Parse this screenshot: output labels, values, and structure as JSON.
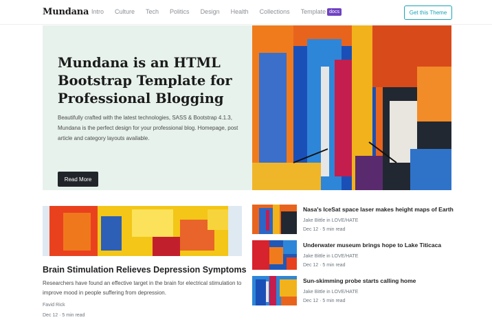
{
  "navbar": {
    "brand": "Mundana",
    "links": [
      "Intro",
      "Culture",
      "Tech",
      "Politics",
      "Design",
      "Health",
      "Collections"
    ],
    "template_label": "Template",
    "docs_badge": "docs",
    "cta": "Get this Theme"
  },
  "hero": {
    "title": "Mundana is an HTML Bootstrap Template for Professional Blogging",
    "text": "Beautifully crafted with the latest technologies, SASS & Bootstrap 4.1.3, Mundana is the perfect design for your professional blog. Homepage, post article and category layouts available.",
    "button": "Read More"
  },
  "featured": {
    "title": "Brain Stimulation Relieves Depression Symptoms",
    "text": "Researchers have found an effective target in the brain for electrical stimulation to improve mood in people suffering from depression.",
    "author": "Favid Rick",
    "date": "Dec 12 · 5 min read"
  },
  "side_articles": [
    {
      "title": "Nasa's IceSat space laser makes height maps of Earth",
      "author": "Jake Bittle in LOVE/HATE",
      "date": "Dec 12 · 5 min read"
    },
    {
      "title": "Underwater museum brings hope to Lake Titicaca",
      "author": "Jake Bittle in LOVE/HATE",
      "date": "Dec 12 · 5 min read"
    },
    {
      "title": "Sun-skimming probe starts calling home",
      "author": "Jake Bittle in LOVE/HATE",
      "date": "Dec 12 · 5 min read"
    }
  ],
  "colors": {
    "accent": "#17a2b8",
    "badge": "#6f42c1",
    "hero_bg": "#e7f2ec",
    "dark_button": "#212529"
  }
}
